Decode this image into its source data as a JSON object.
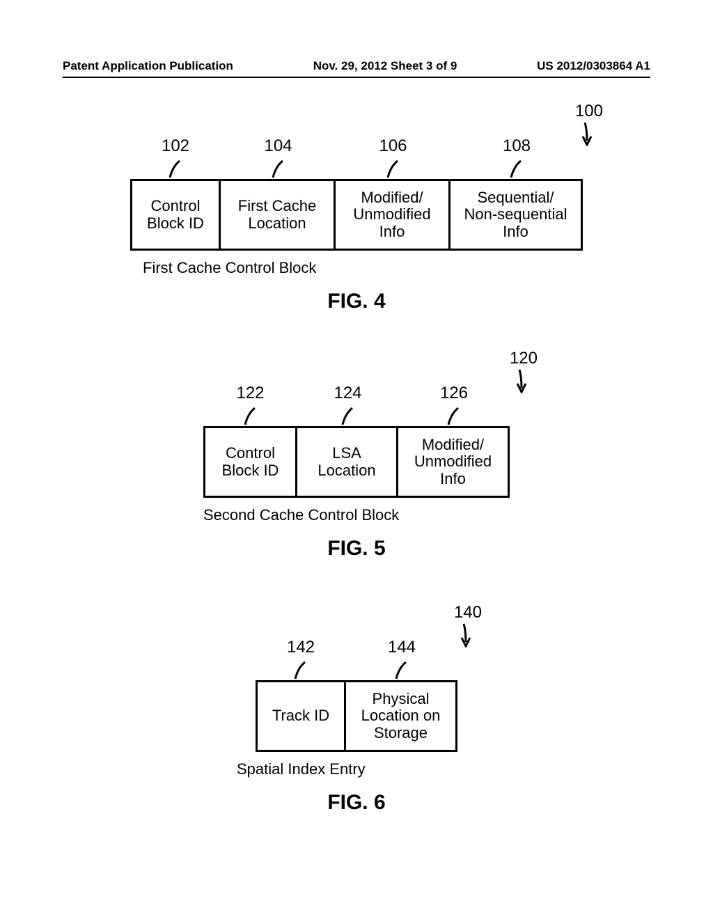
{
  "header": {
    "left": "Patent Application Publication",
    "center": "Nov. 29, 2012  Sheet 3 of 9",
    "right": "US 2012/0303864 A1"
  },
  "fig4": {
    "overall_ref": "100",
    "refs": [
      "102",
      "104",
      "106",
      "108"
    ],
    "cells": [
      "Control\nBlock ID",
      "First Cache\nLocation",
      "Modified/\nUnmodified\nInfo",
      "Sequential/\nNon-sequential\nInfo"
    ],
    "caption": "First Cache Control Block",
    "label": "FIG. 4"
  },
  "fig5": {
    "overall_ref": "120",
    "refs": [
      "122",
      "124",
      "126"
    ],
    "cells": [
      "Control\nBlock ID",
      "LSA\nLocation",
      "Modified/\nUnmodified\nInfo"
    ],
    "caption": "Second Cache Control Block",
    "label": "FIG. 5"
  },
  "fig6": {
    "overall_ref": "140",
    "refs": [
      "142",
      "144"
    ],
    "cells": [
      "Track ID",
      "Physical\nLocation on\nStorage"
    ],
    "caption": "Spatial Index Entry",
    "label": "FIG. 6"
  }
}
